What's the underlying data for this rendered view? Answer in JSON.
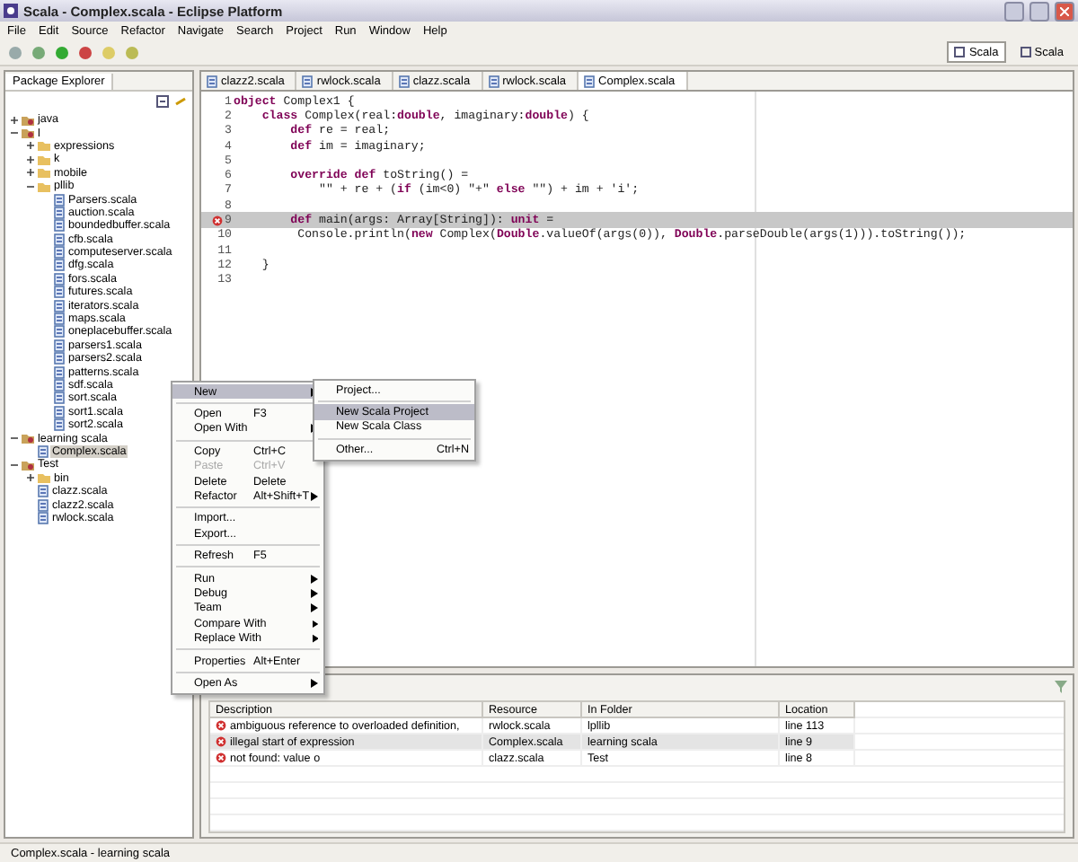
{
  "window": {
    "title": "Scala - Complex.scala - Eclipse Platform"
  },
  "menu_bar": [
    "File",
    "Edit",
    "Source",
    "Refactor",
    "Navigate",
    "Search",
    "Project",
    "Run",
    "Window",
    "Help"
  ],
  "perspectives": [
    {
      "label": "Scala",
      "selected": true
    },
    {
      "label": "Scala",
      "selected": false
    }
  ],
  "package_explorer": {
    "title": "Package Explorer",
    "tree": [
      {
        "label": "java",
        "kind": "project",
        "expanded": false,
        "selected": false
      },
      {
        "label": "l",
        "kind": "project",
        "expanded": true,
        "selected": false,
        "children": [
          {
            "label": "expressions",
            "kind": "folder",
            "expanded": false,
            "selected": false
          },
          {
            "label": "k",
            "kind": "folder",
            "expanded": false,
            "selected": false
          },
          {
            "label": "mobile",
            "kind": "folder",
            "expanded": false,
            "selected": false
          },
          {
            "label": "pllib",
            "kind": "folder",
            "expanded": true,
            "selected": false,
            "children": [
              {
                "label": "Parsers.scala",
                "kind": "file",
                "selected": false
              },
              {
                "label": "auction.scala",
                "kind": "file",
                "selected": false
              },
              {
                "label": "boundedbuffer.scala",
                "kind": "file",
                "selected": false
              },
              {
                "label": "cfb.scala",
                "kind": "file",
                "selected": false
              },
              {
                "label": "computeserver.scala",
                "kind": "file",
                "selected": false
              },
              {
                "label": "dfg.scala",
                "kind": "file",
                "selected": false
              },
              {
                "label": "fors.scala",
                "kind": "file",
                "selected": false
              },
              {
                "label": "futures.scala",
                "kind": "file",
                "selected": false
              },
              {
                "label": "iterators.scala",
                "kind": "file",
                "selected": false
              },
              {
                "label": "maps.scala",
                "kind": "file",
                "selected": false
              },
              {
                "label": "oneplacebuffer.scala",
                "kind": "file",
                "selected": false
              },
              {
                "label": "parsers1.scala",
                "kind": "file",
                "selected": false
              },
              {
                "label": "parsers2.scala",
                "kind": "file",
                "selected": false
              },
              {
                "label": "patterns.scala",
                "kind": "file",
                "selected": false
              },
              {
                "label": "sdf.scala",
                "kind": "file",
                "selected": false
              },
              {
                "label": "sort.scala",
                "kind": "file",
                "selected": false
              },
              {
                "label": "sort1.scala",
                "kind": "file",
                "selected": false
              },
              {
                "label": "sort2.scala",
                "kind": "file",
                "selected": false
              }
            ]
          }
        ]
      },
      {
        "label": "learning scala",
        "kind": "project",
        "expanded": true,
        "selected": false,
        "children": [
          {
            "label": "Complex.scala",
            "kind": "file",
            "selected": true
          }
        ]
      },
      {
        "label": "Test",
        "kind": "project",
        "expanded": true,
        "selected": false,
        "children": [
          {
            "label": "bin",
            "kind": "folder",
            "expanded": false,
            "selected": false
          },
          {
            "label": "clazz.scala",
            "kind": "file",
            "selected": false
          },
          {
            "label": "clazz2.scala",
            "kind": "file",
            "selected": false
          },
          {
            "label": "rwlock.scala",
            "kind": "file",
            "selected": false
          }
        ]
      }
    ]
  },
  "editor": {
    "tabs": [
      {
        "label": "clazz2.scala",
        "selected": false
      },
      {
        "label": "rwlock.scala",
        "selected": false
      },
      {
        "label": "clazz.scala",
        "selected": false
      },
      {
        "label": "rwlock.scala",
        "selected": false
      },
      {
        "label": "Complex.scala",
        "selected": true
      }
    ],
    "lines": [
      {
        "number": "1",
        "text": "**object** Complex1 {",
        "current": false,
        "error": false
      },
      {
        "number": "2",
        "text": "    **class** Complex(real:**double**, imaginary:**double**) {",
        "current": false,
        "error": false
      },
      {
        "number": "3",
        "text": "        **def** re = real;",
        "current": false,
        "error": false
      },
      {
        "number": "4",
        "text": "        **def** im = imaginary;",
        "current": false,
        "error": false
      },
      {
        "number": "5",
        "current": false,
        "error": false
      },
      {
        "number": "6",
        "text": "        **override** **def** toString() =",
        "current": false,
        "error": false
      },
      {
        "number": "7",
        "text": "            \"\" + re + (**if** (im<0) \"+\" **else** \"\") + im + 'i';",
        "current": false,
        "error": false
      },
      {
        "number": "8",
        "current": false,
        "error": false
      },
      {
        "number": "9",
        "text": "        **def** main(args: Array[String]): **unit** =",
        "current": true,
        "error": true
      },
      {
        "number": "10",
        "text": "         Console.println(**new** Complex(**Double**.valueOf(args(0)), **Double**.parseDouble(args(1))).toString());",
        "current": false,
        "error": false
      },
      {
        "number": "11",
        "current": false,
        "error": false
      },
      {
        "number": "12",
        "text": "    }",
        "current": false,
        "error": false
      },
      {
        "number": "13",
        "current": false,
        "error": false
      }
    ]
  },
  "problems": {
    "columns": [
      "Description",
      "Resource",
      "In Folder",
      "Location"
    ],
    "rows": [
      {
        "description": "ambiguous reference to overloaded definition,",
        "resource": "rwlock.scala",
        "folder": "lpllib",
        "location": "line 113",
        "selected": false
      },
      {
        "description": "illegal start of expression",
        "resource": "Complex.scala",
        "folder": "learning scala",
        "location": "line 9",
        "selected": true
      },
      {
        "description": "not found: value o",
        "resource": "clazz.scala",
        "folder": "Test",
        "location": "line 8",
        "selected": false
      }
    ]
  },
  "context_menu": [
    {
      "kind": "item",
      "label": "New",
      "submenu": true,
      "selected": true,
      "disabled": false
    },
    {
      "kind": "separator"
    },
    {
      "kind": "item",
      "label": "Open",
      "shortcut": "F3",
      "submenu": false,
      "selected": false,
      "disabled": false
    },
    {
      "kind": "item",
      "label": "Open With",
      "submenu": true,
      "selected": false,
      "disabled": false
    },
    {
      "kind": "separator"
    },
    {
      "kind": "item",
      "label": "Copy",
      "shortcut": "Ctrl+C",
      "submenu": false,
      "selected": false,
      "disabled": false
    },
    {
      "kind": "item",
      "label": "Paste",
      "shortcut": "Ctrl+V",
      "submenu": false,
      "selected": false,
      "disabled": true
    },
    {
      "kind": "item",
      "label": "Delete",
      "shortcut": "Delete",
      "submenu": false,
      "selected": false,
      "disabled": false
    },
    {
      "kind": "item",
      "label": "Refactor",
      "shortcut": "Alt+Shift+T",
      "submenu": true,
      "selected": false,
      "disabled": false
    },
    {
      "kind": "separator"
    },
    {
      "kind": "item",
      "label": "Import...",
      "submenu": false,
      "selected": false,
      "disabled": false
    },
    {
      "kind": "item",
      "label": "Export...",
      "submenu": false,
      "selected": false,
      "disabled": false
    },
    {
      "kind": "separator"
    },
    {
      "kind": "item",
      "label": "Refresh",
      "shortcut": "F5",
      "submenu": false,
      "selected": false,
      "disabled": false
    },
    {
      "kind": "separator"
    },
    {
      "kind": "item",
      "label": "Run",
      "submenu": true,
      "selected": false,
      "disabled": false
    },
    {
      "kind": "item",
      "label": "Debug",
      "submenu": true,
      "selected": false,
      "disabled": false
    },
    {
      "kind": "item",
      "label": "Team",
      "submenu": true,
      "selected": false,
      "disabled": false
    },
    {
      "kind": "item",
      "label": "Compare With",
      "submenu": true,
      "selected": false,
      "disabled": false
    },
    {
      "kind": "item",
      "label": "Replace With",
      "submenu": true,
      "selected": false,
      "disabled": false
    },
    {
      "kind": "separator"
    },
    {
      "kind": "item",
      "label": "Properties",
      "shortcut": "Alt+Enter",
      "submenu": false,
      "selected": false,
      "disabled": false
    },
    {
      "kind": "separator"
    },
    {
      "kind": "item",
      "label": "Open As",
      "submenu": true,
      "selected": false,
      "disabled": false
    }
  ],
  "submenu": [
    {
      "kind": "item",
      "label": "Project...",
      "selected": false
    },
    {
      "kind": "separator"
    },
    {
      "kind": "item",
      "label": "New Scala Project",
      "selected": true
    },
    {
      "kind": "item",
      "label": "New Scala Class",
      "selected": false
    },
    {
      "kind": "separator"
    },
    {
      "kind": "item",
      "label": "Other...",
      "shortcut": "Ctrl+N",
      "selected": false
    }
  ],
  "status_bar": "Complex.scala - learning scala"
}
